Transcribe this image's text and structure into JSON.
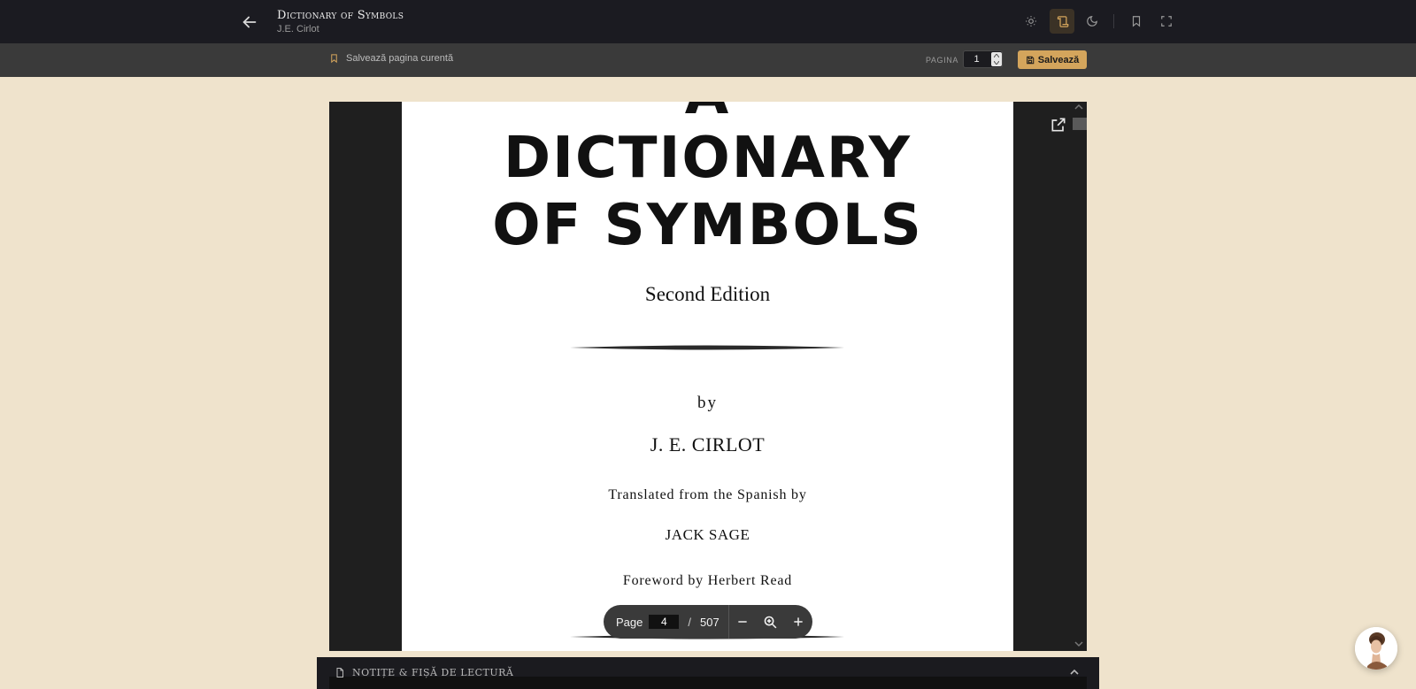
{
  "header": {
    "title": "Dictionary of Symbols",
    "author": "J.E. Cirlot",
    "icons": [
      "arrow-left-icon",
      "sun-icon",
      "scroll-icon",
      "moon-icon",
      "bookmark-icon",
      "fullscreen-icon"
    ]
  },
  "subbar": {
    "save_current_label": "Salvează pagina curentă",
    "page_label": "PAGINA",
    "page_value": "1",
    "save_button_label": "Salvează"
  },
  "document": {
    "title_partial": "A",
    "title_line1": "DICTIONARY",
    "title_line2": "OF SYMBOLS",
    "edition": "Second Edition",
    "by": "by",
    "author": "J. E. CIRLOT",
    "translated": "Translated from the Spanish by",
    "translator": "JACK SAGE",
    "foreword": "Foreword by Herbert Read"
  },
  "pdf_toolbar": {
    "page_label": "Page",
    "current_page": "4",
    "separator": "/",
    "total_pages": "507"
  },
  "notes": {
    "label": "NOTIȚE & FIȘĂ DE LECTURĂ"
  },
  "colors": {
    "background": "#efe3cc",
    "topbar": "#1b1b21",
    "accent": "#d4a55c"
  }
}
